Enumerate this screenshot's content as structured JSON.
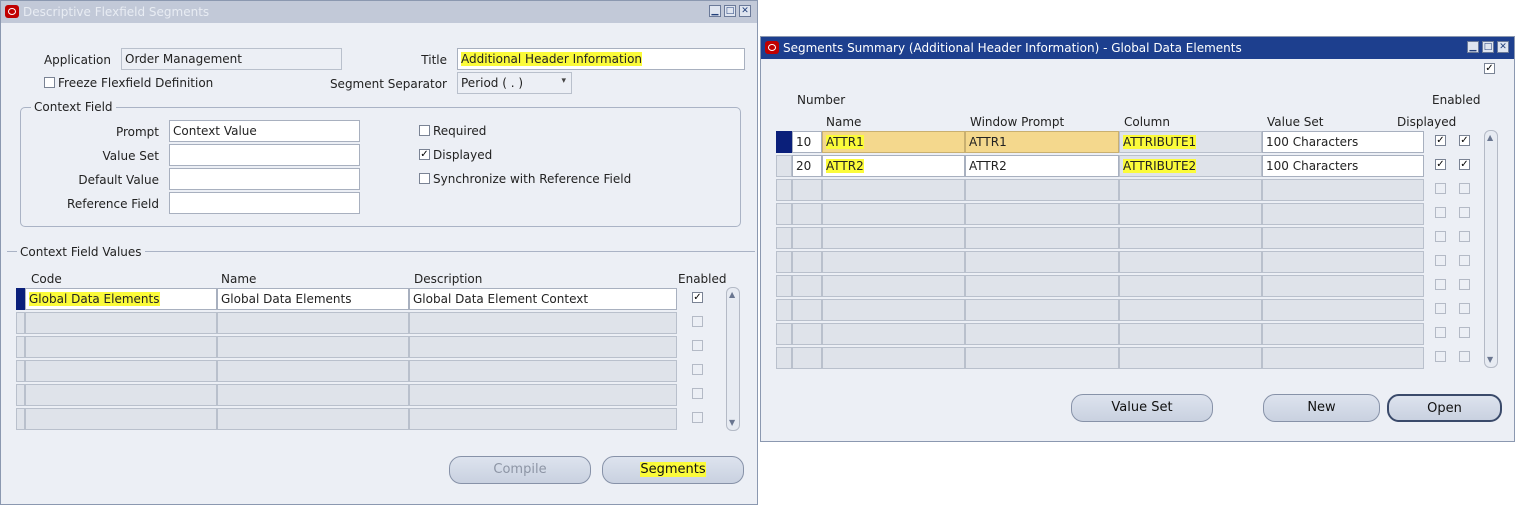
{
  "left_window": {
    "title": "Descriptive Flexfield Segments",
    "application_label": "Application",
    "application_value": "Order Management",
    "title_label": "Title",
    "title_value": "Additional Header Information",
    "freeze_label": "Freeze Flexfield Definition",
    "segment_separator_label": "Segment Separator",
    "segment_separator_value": "Period ( . )",
    "context_field": {
      "group_title": "Context Field",
      "prompt_label": "Prompt",
      "prompt_value": "Context Value",
      "value_set_label": "Value Set",
      "value_set_value": "",
      "default_value_label": "Default Value",
      "default_value_value": "",
      "reference_field_label": "Reference Field",
      "reference_field_value": "",
      "required_label": "Required",
      "displayed_label": "Displayed",
      "synchronize_label": "Synchronize with Reference Field"
    },
    "context_values": {
      "title": "Context Field Values",
      "col_code": "Code",
      "col_name": "Name",
      "col_description": "Description",
      "col_enabled": "Enabled",
      "rows": [
        {
          "code": "Global Data Elements",
          "name": "Global Data Elements",
          "description": "Global Data Element Context",
          "enabled": true
        }
      ]
    },
    "buttons": {
      "compile": "Compile",
      "segments": "Segments"
    }
  },
  "right_window": {
    "title": "Segments Summary (Additional Header Information) - Global Data Elements",
    "col_number": "Number",
    "col_name": "Name",
    "col_window_prompt": "Window Prompt",
    "col_column": "Column",
    "col_value_set": "Value Set",
    "col_displayed": "Displayed",
    "col_enabled": "Enabled",
    "rows": [
      {
        "number": "10",
        "name": "ATTR1",
        "window_prompt": "ATTR1",
        "column": "ATTRIBUTE1",
        "value_set": "100 Characters",
        "displayed": true,
        "enabled": true
      },
      {
        "number": "20",
        "name": "ATTR2",
        "window_prompt": "ATTR2",
        "column": "ATTRIBUTE2",
        "value_set": "100 Characters",
        "displayed": true,
        "enabled": true
      }
    ],
    "buttons": {
      "value_set": "Value Set",
      "new": "New",
      "open": "Open"
    }
  }
}
